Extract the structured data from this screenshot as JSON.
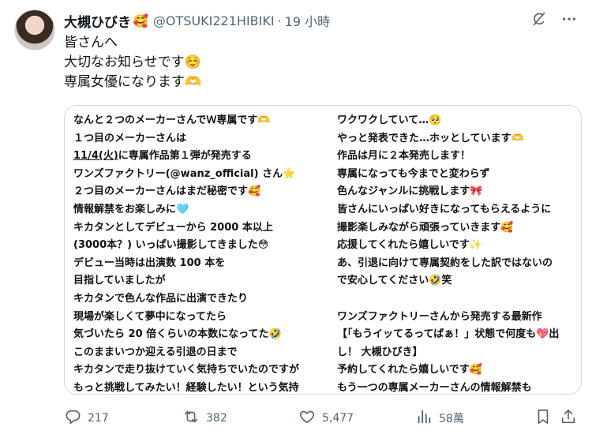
{
  "author": {
    "name": "大槻ひびき",
    "name_emoji": "🥰",
    "handle": "@OTSUKI221HIBIKI",
    "separator": "·",
    "time": "19 小時"
  },
  "post_text": [
    "皆さんへ",
    "大切なお知らせです☺️",
    "専属女優になります🫶"
  ],
  "card": {
    "left_lines": [
      "なんと２つのメーカーさんでＷ専属です🫶",
      "１つ目のメーカーさんは",
      "11/4(火)",
      "に専属作品第１弾が発売する",
      "ワンズファクトリー(@wanz_official) さん⭐",
      "２つ目のメーカーさんはまだ秘密です🥰",
      "情報解禁をお楽しみに🩵",
      "キカタンとしてデビューから 2000 本以上",
      "(3000本？) いっぱい撮影してきました😳",
      "デビュー当時は出演数 100 本を",
      "目指していましたが",
      "キカタンで色んな作品に出演できたり",
      "現場が楽しくて夢中になってたら",
      "気づいたら 20 倍くらいの本数になってた🤣",
      "このままいつか迎える引退の日まで",
      "キカタンで走り抜けていく気持ちでいたのですが",
      "もっと挑戦してみたい！経験したい！という気持"
    ],
    "right_lines": [
      "ワクワクしていて…🥺",
      "やっと発表できた…ホッとしています🫶",
      "作品は月に２本発売します！",
      "専属になっても今までと変わらず",
      "色んなジャンルに挑戦します🎀",
      "皆さんにいっぱい好きになってもらえるように",
      "撮影楽しみながら頑張っていきます🥰",
      "応援してくれたら嬉しいです✨",
      "あ、引退に向けて専属契約をした訳ではないの",
      "で安心してください🤣笑",
      "",
      "ワンズファクトリーさんから発売する最新作",
      "【「もうイッてるってばぁ！」状態で何度も💖出",
      "し！ 大槻ひびき】",
      "予約してくれたら嬉しいです🥰",
      "もう一つの専属メーカーさんの情報解禁も"
    ]
  },
  "actions": {
    "reply_count": "217",
    "retweet_count": "382",
    "like_count": "5,477",
    "views_count": "58萬"
  },
  "icons": [
    "grok-icon",
    "more-icon",
    "reply-icon",
    "retweet-icon",
    "like-icon",
    "views-icon",
    "bookmark-icon",
    "share-icon"
  ]
}
